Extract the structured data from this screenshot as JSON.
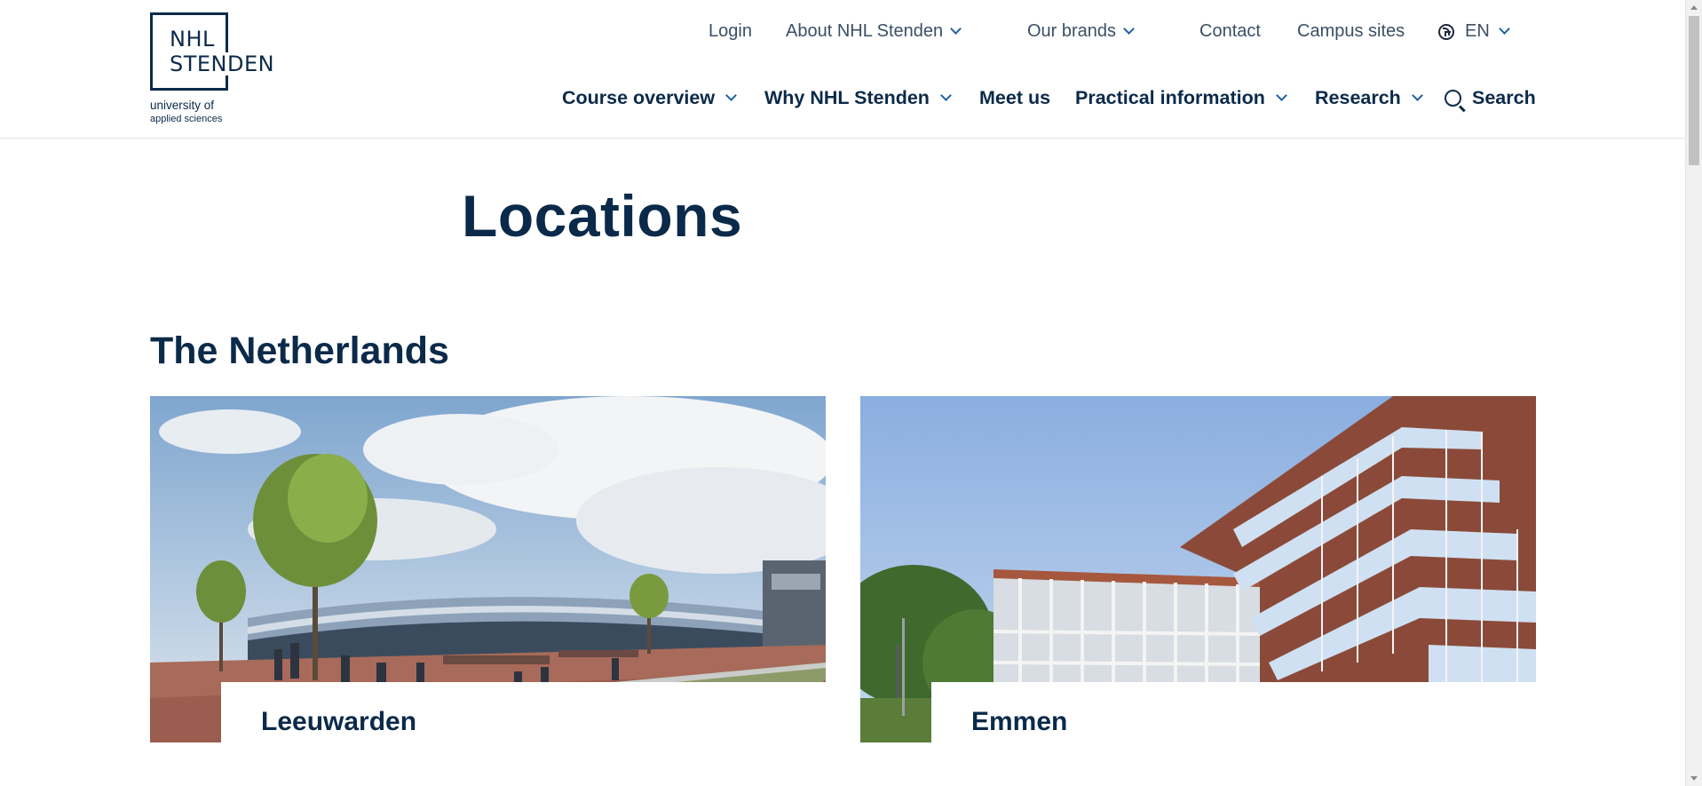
{
  "logo": {
    "line1": "NHL",
    "line2": "STENDEN",
    "sub1": "university of",
    "sub2": "applied sciences"
  },
  "top_nav": [
    {
      "label": "Login",
      "dropdown": false
    },
    {
      "label": "About NHL Stenden",
      "dropdown": true
    },
    {
      "label": "Our brands",
      "dropdown": true
    },
    {
      "label": "Contact",
      "dropdown": false
    },
    {
      "label": "Campus sites",
      "dropdown": false
    },
    {
      "label": "EN",
      "dropdown": true,
      "icon": "globe-icon"
    }
  ],
  "main_nav": [
    {
      "label": "Course overview",
      "dropdown": true
    },
    {
      "label": "Why NHL Stenden",
      "dropdown": true
    },
    {
      "label": "Meet us",
      "dropdown": false
    },
    {
      "label": "Practical information",
      "dropdown": true
    },
    {
      "label": "Research",
      "dropdown": true
    },
    {
      "label": "Search",
      "dropdown": false,
      "icon": "search-icon"
    }
  ],
  "page": {
    "title": "Locations",
    "section_title": "The Netherlands"
  },
  "locations": [
    {
      "name": "Leeuwarden"
    },
    {
      "name": "Emmen"
    }
  ],
  "colors": {
    "primary": "#0b2a4a",
    "accent": "#1f5fa8",
    "muted_text": "#3b4f66"
  }
}
